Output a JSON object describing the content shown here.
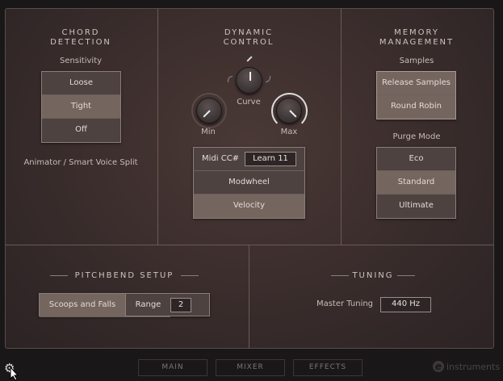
{
  "chord": {
    "title": "CHORD\nDETECTION",
    "sensitivity_label": "Sensitivity",
    "options": [
      "Loose",
      "Tight",
      "Off"
    ],
    "selected": "Tight",
    "animator_label": "Animator / Smart Voice Split"
  },
  "dynamic": {
    "title": "DYNAMIC\nCONTROL",
    "curve_label": "Curve",
    "min_label": "Min",
    "max_label": "Max",
    "midi_label": "Midi CC#",
    "learn_value": "Learn 11",
    "options": [
      "Modwheel",
      "Velocity"
    ],
    "selected": "Velocity"
  },
  "memory": {
    "title": "MEMORY\nMANAGEMENT",
    "samples_label": "Samples",
    "samples": [
      "Release Samples",
      "Round Robin"
    ],
    "purge_label": "Purge Mode",
    "purge_options": [
      "Eco",
      "Standard",
      "Ultimate"
    ],
    "purge_selected": "Standard"
  },
  "pitchbend": {
    "title": "PITCHBEND SETUP",
    "mode": "Scoops and Falls",
    "range_label": "Range",
    "range_value": "2"
  },
  "tuning": {
    "title": "TUNING",
    "master_label": "Master Tuning",
    "master_value": "440 Hz"
  },
  "nav": {
    "tabs": [
      "MAIN",
      "MIXER",
      "EFFECTS"
    ]
  },
  "brand": {
    "logo_letter": "e",
    "name": "instruments"
  },
  "icons": {
    "settings": "gear-icon",
    "cursor": "mouse-cursor"
  }
}
